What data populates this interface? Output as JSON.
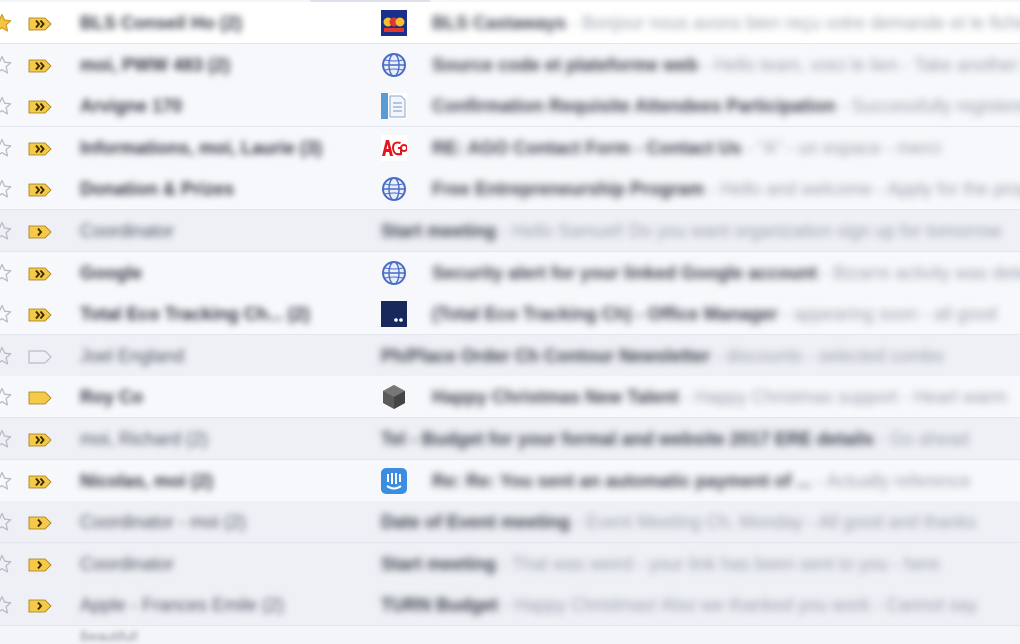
{
  "colors": {
    "star_active": "#f5c342",
    "star_inactive": "#b8bcc6",
    "important_fill": "#f7c948",
    "important_outline": "#a07a10",
    "row_read_bg": "#eef0f5",
    "row_unread_bg": "#f7f8fb"
  },
  "messages": [
    {
      "starred": true,
      "importance": "double",
      "sender": "BLS Conseil Ho (2)",
      "avatar": "colorful-badge-icon",
      "subject": "BLS Castaways",
      "snippet": " - Bonjour nous avons bien reçu votre demande et le fichier joint",
      "state": "hover"
    },
    {
      "starred": false,
      "importance": "double",
      "sender": "moi, PWW 483 (2)",
      "avatar": "globe-icon",
      "subject": "Source code et plateforme web",
      "snippet": " - Hello team, voici le lien - Take another look",
      "state": "unread"
    },
    {
      "starred": false,
      "importance": "double",
      "sender": "Arvigne 170",
      "avatar": "document-icon",
      "subject": "Confirmation Requisite Attendees Participation",
      "snippet": " - Successfully registered for the session",
      "state": "unread"
    },
    {
      "starred": false,
      "importance": "double",
      "sender": "Informations, moi, Laurie (3)",
      "avatar": "ago-logo-icon",
      "subject": "RE: AGO Contact Form - Contact Us",
      "snippet": " - \"A\" - un espace - merci",
      "state": "unread"
    },
    {
      "starred": false,
      "importance": "double",
      "sender": "Donation & Prizes",
      "avatar": "globe-icon",
      "subject": "Free Entrepreneurship Program",
      "snippet": " - Hello and welcome - Apply for the program today",
      "state": "unread"
    },
    {
      "starred": false,
      "importance": "single",
      "sender": "Coordinator",
      "avatar": "",
      "subject": "Start meeting",
      "snippet": " - Hello Samuel! Do you want organization sign up for tomorrow",
      "state": "read"
    },
    {
      "starred": false,
      "importance": "double",
      "sender": "Google",
      "avatar": "globe-icon",
      "subject": "Security alert for your linked Google account",
      "snippet": " - Bizarre activity was detected",
      "state": "unread"
    },
    {
      "starred": false,
      "importance": "double",
      "sender": "Total Eco Tracking Ch... (2)",
      "avatar": "dark-square-icon",
      "subject": "(Total Eco Tracking Ch) - Office Manager",
      "snippet": " - appearing soon - all good",
      "state": "unread"
    },
    {
      "starred": false,
      "importance": "none",
      "sender": "Joel England",
      "avatar": "",
      "subject": "Ph/Place Order Ch Contour Newsletter",
      "snippet": " - discounts - selected combo",
      "state": "read"
    },
    {
      "starred": false,
      "importance": "flag",
      "sender": "Roy Co",
      "avatar": "cube-icon",
      "subject": "Happy Christmas New Talent",
      "snippet": " - Happy Christmas support - Heart warm",
      "state": "unread"
    },
    {
      "starred": false,
      "importance": "double",
      "sender": "moi, Richard (2)",
      "avatar": "",
      "subject": "Tel - Budget for your formal and website 2017 ERE details",
      "snippet": " - Go ahead",
      "state": "read"
    },
    {
      "starred": false,
      "importance": "double",
      "sender": "Nicolas, moi (2)",
      "avatar": "intercom-icon",
      "subject": "Re: Re: You sent an automatic payment of ...",
      "snippet": " - Actually reference",
      "state": "unread"
    },
    {
      "starred": false,
      "importance": "single",
      "sender": "Coordinator - moi (2)",
      "avatar": "",
      "subject": "Date of Event meeting",
      "snippet": " - Event Meeting Ch, Monday - All good and thanks",
      "state": "read"
    },
    {
      "starred": false,
      "importance": "single",
      "sender": "Coordinator",
      "avatar": "",
      "subject": "Start meeting",
      "snippet": " - That was weird - your link has been sent to you - here",
      "state": "read"
    },
    {
      "starred": false,
      "importance": "single",
      "sender": "Apple - Frances Emile (2)",
      "avatar": "",
      "subject": "TURN Budget",
      "snippet": " - Happy Christmas! Also we thanked you work - Cannot say",
      "state": "read"
    }
  ],
  "footer": {
    "text": "Beautiful!"
  }
}
